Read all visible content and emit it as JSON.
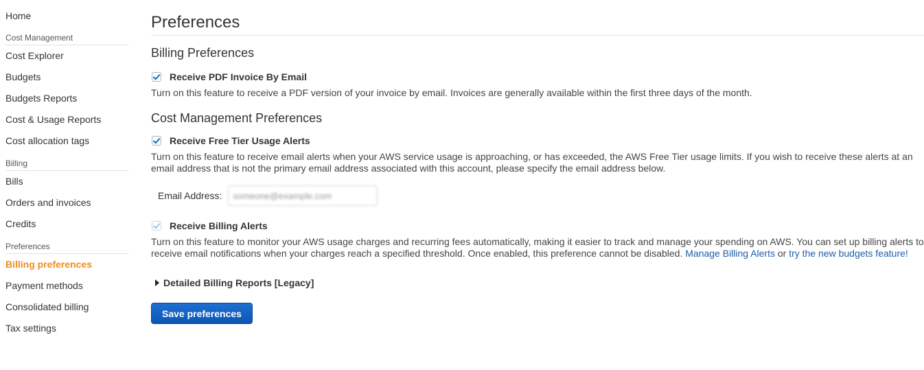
{
  "sidebar": {
    "home": "Home",
    "sections": [
      {
        "title": "Cost Management",
        "items": [
          "Cost Explorer",
          "Budgets",
          "Budgets Reports",
          "Cost & Usage Reports",
          "Cost allocation tags"
        ]
      },
      {
        "title": "Billing",
        "items": [
          "Bills",
          "Orders and invoices",
          "Credits"
        ]
      },
      {
        "title": "Preferences",
        "items": [
          "Billing preferences",
          "Payment methods",
          "Consolidated billing",
          "Tax settings"
        ]
      }
    ],
    "active_item": "Billing preferences",
    "active_color": "#f08c1c"
  },
  "main": {
    "title": "Preferences",
    "billing": {
      "title": "Billing Preferences",
      "pdf_invoice": {
        "label": "Receive PDF Invoice By Email",
        "checked": true,
        "description": "Turn on this feature to receive a PDF version of your invoice by email. Invoices are generally available within the first three days of the month."
      }
    },
    "cost_mgmt": {
      "title": "Cost Management Preferences",
      "free_tier": {
        "label": "Receive Free Tier Usage Alerts",
        "checked": true,
        "description": "Turn on this feature to receive email alerts when your AWS service usage is approaching, or has exceeded, the AWS Free Tier usage limits. If you wish to receive these alerts at an email address that is not the primary email address associated with this account, please specify the email address below."
      },
      "email": {
        "label": "Email Address:",
        "value": "someone@example.com"
      },
      "billing_alerts": {
        "label": "Receive Billing Alerts",
        "checked": true,
        "disabled": true,
        "description": "Turn on this feature to monitor your AWS usage charges and recurring fees automatically, making it easier to track and manage your spending on AWS. You can set up billing alerts to receive email notifications when your charges reach a specified threshold. Once enabled, this preference cannot be disabled.",
        "link1": "Manage Billing Alerts",
        "or_text": "or",
        "link2": "try the new budgets feature!"
      }
    },
    "detailed_reports": {
      "label": "Detailed Billing Reports [Legacy]",
      "expanded": false
    },
    "save_button": "Save preferences"
  },
  "colors": {
    "link": "#1f5ea8",
    "button": "#0b5cbf",
    "check": "#1f6fbf",
    "check_disabled": "#a9c6e2"
  }
}
